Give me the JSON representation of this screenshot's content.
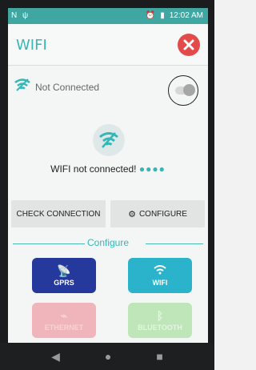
{
  "status_bar": {
    "left_icons": "N ψ",
    "time": "12:02 AM",
    "icons": [
      "alarm-icon",
      "battery-icon"
    ]
  },
  "header": {
    "title": "WIFI",
    "close_icon": "close-icon",
    "close_color": "#e34a4a"
  },
  "connection": {
    "status_label": "Not Connected",
    "toggle_on": false,
    "message": "WIFI not connected!",
    "message_dots": "●●●●"
  },
  "actions": {
    "check_label": "CHECK CONNECTION",
    "configure_label": "CONFIGURE"
  },
  "configure": {
    "section_title": "Configure",
    "tiles": [
      {
        "label": "GPRS",
        "icon": "antenna-icon",
        "color": "#25389b"
      },
      {
        "label": "WIFI",
        "icon": "wifi-icon",
        "color": "#2bb3cc"
      },
      {
        "label": "ETHERNET",
        "icon": "ethernet-icon",
        "color": "#f0b5ba"
      },
      {
        "label": "BLUETOOTH",
        "icon": "bluetooth-icon",
        "color": "#bfe6b8"
      }
    ]
  },
  "navbar": {
    "back": "◀",
    "home": "●",
    "recent": "■"
  },
  "colors": {
    "accent": "#35b7b7",
    "status_bar": "#3fa6a1"
  }
}
